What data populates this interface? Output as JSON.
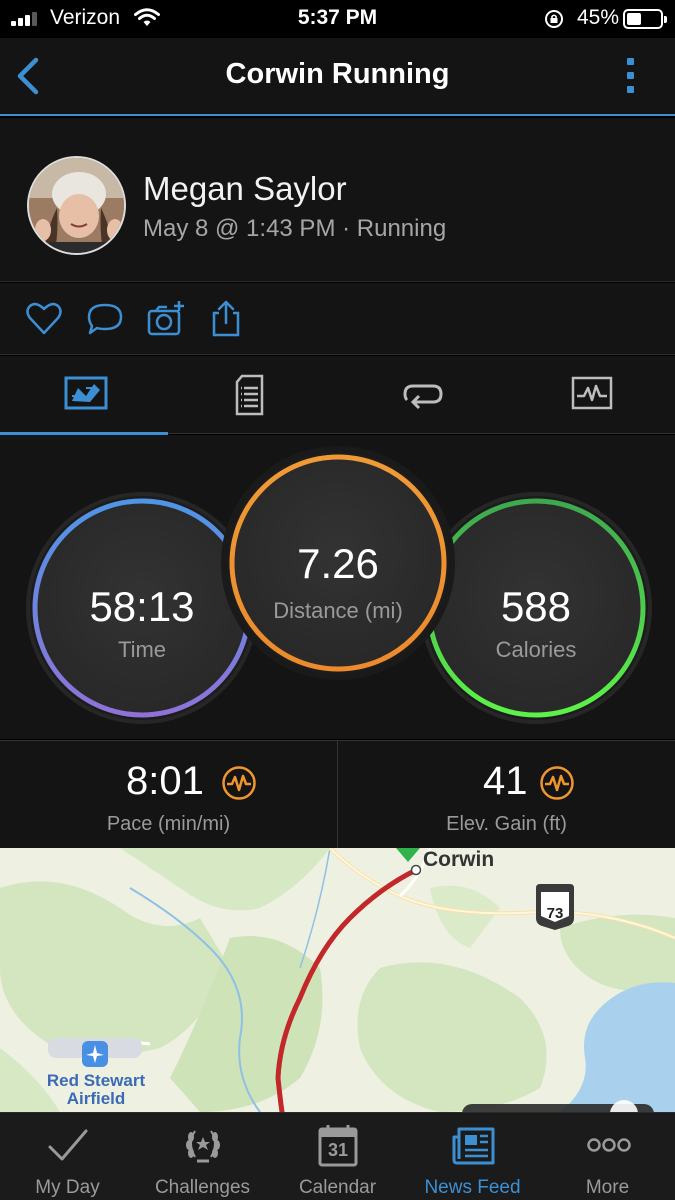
{
  "status_bar": {
    "carrier": "Verizon",
    "time": "5:37 PM",
    "battery": "45%",
    "icons": [
      "signal-icon",
      "wifi-icon",
      "orientation-lock-icon",
      "battery-icon"
    ]
  },
  "header": {
    "title": "Corwin Running",
    "back_icon": "chevron-left-icon",
    "menu_icon": "kebab-menu-icon"
  },
  "profile": {
    "name": "Megan Saylor",
    "meta": "May 8 @ 1:43 PM · Running"
  },
  "actions": [
    "heart-icon",
    "comment-icon",
    "add-photo-icon",
    "share-icon"
  ],
  "tabs": [
    {
      "icon": "map-tab-icon",
      "active": true
    },
    {
      "icon": "details-tab-icon",
      "active": false
    },
    {
      "icon": "laps-tab-icon",
      "active": false
    },
    {
      "icon": "charts-tab-icon",
      "active": false
    }
  ],
  "circles": {
    "time": {
      "value": "58:13",
      "label": "Time"
    },
    "distance": {
      "value": "7.26",
      "label": "Distance (mi)"
    },
    "calories": {
      "value": "588",
      "label": "Calories"
    }
  },
  "stats": {
    "pace": {
      "value": "8:01",
      "label": "Pace (min/mi)"
    },
    "elevation": {
      "value": "41",
      "label": "Elev. Gain (ft)"
    }
  },
  "map": {
    "town": "Corwin",
    "route_shield": "73",
    "airfield": "Red Stewart Airfield"
  },
  "tabbar": [
    {
      "label": "My Day",
      "icon": "checkmark-icon",
      "active": false
    },
    {
      "label": "Challenges",
      "icon": "laurel-icon",
      "active": false
    },
    {
      "label": "Calendar",
      "icon": "calendar-icon",
      "day": "31",
      "active": false
    },
    {
      "label": "News Feed",
      "icon": "newspaper-icon",
      "active": true
    },
    {
      "label": "More",
      "icon": "more-dots-icon",
      "active": false
    }
  ],
  "colors": {
    "accent": "#3d8fd4",
    "time_ring": "#5b8fe0",
    "distance_ring": "#f0962e",
    "calories_ring": "#4fd64a",
    "route": "#c2282a"
  }
}
